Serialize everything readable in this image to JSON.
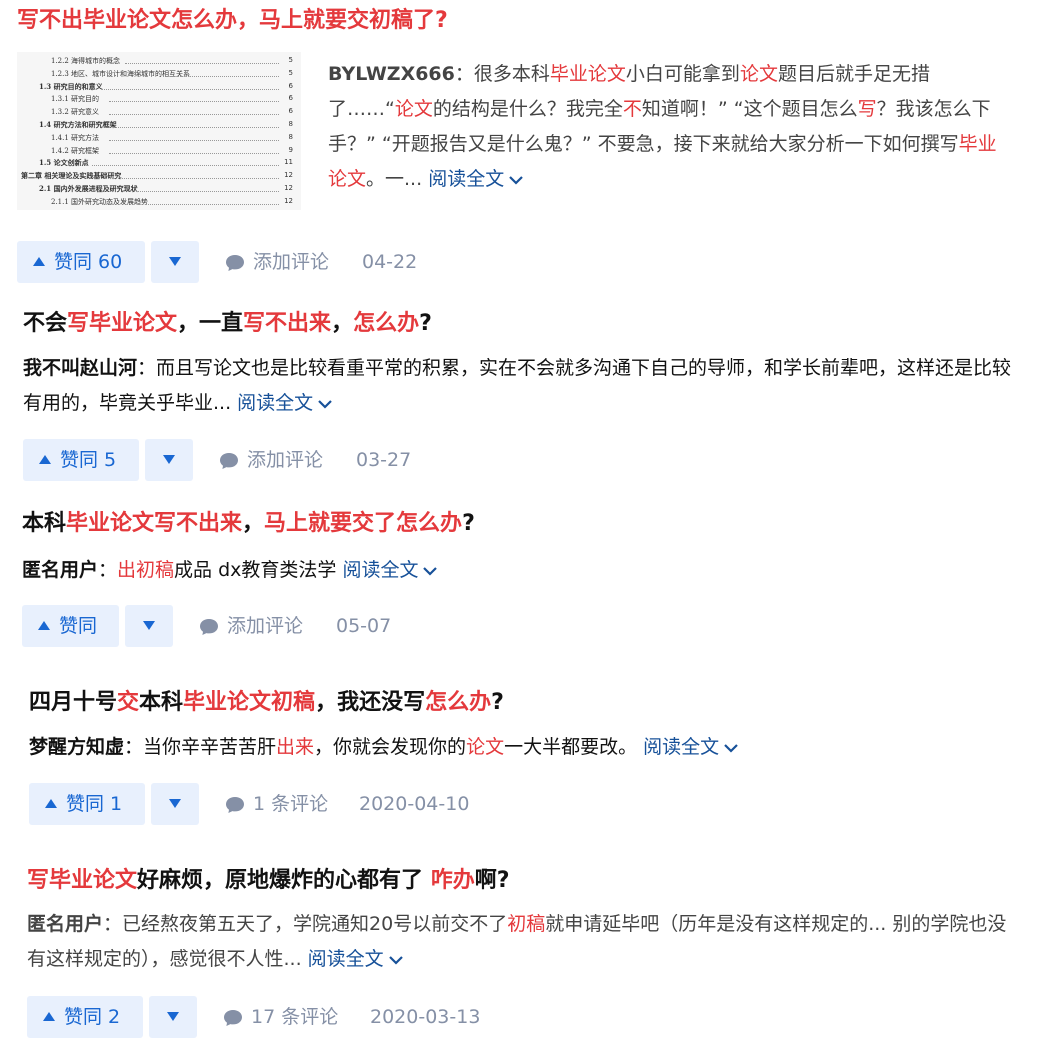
{
  "colors": {
    "highlight": "#e4393c",
    "link": "#175199",
    "vote_bg": "#e8f0fd",
    "vote_text": "#1967d2",
    "meta": "#8590a6"
  },
  "icons": {
    "comment": "speech-bubble-icon",
    "read_more": "chevron-down-icon",
    "upvote": "triangle-up-icon",
    "downvote": "triangle-down-icon"
  },
  "read_more_label": "阅读全文",
  "items": [
    {
      "title": [
        {
          "t": "写不出毕业论文怎么办，马上就要交初稿了?",
          "hl": true
        }
      ],
      "thumbnail": {
        "lines": [
          {
            "text": "1.2.2 海得城市的概念",
            "page": "5"
          },
          {
            "text": "1.2.3 地区、城市设计和海绵城市的相互关系",
            "page": "5"
          },
          {
            "text": "1.3 研究目的和意义",
            "page": "6"
          },
          {
            "text": "1.3.1 研究目的",
            "page": "6"
          },
          {
            "text": "1.3.2 研究意义",
            "page": "6"
          },
          {
            "text": "1.4 研究方法和研究框架",
            "page": "8"
          },
          {
            "text": "1.4.1 研究方法",
            "page": "8"
          },
          {
            "text": "1.4.2 研究框架",
            "page": "9"
          },
          {
            "text": "1.5 论文创新点",
            "page": "11"
          },
          {
            "text": "第二章 相关理论及实践基础研究",
            "page": "12"
          },
          {
            "text": "2.1 国内外发展进程及研究现状",
            "page": "12"
          },
          {
            "text": "2.1.1 国外研究动态及发展趋势",
            "page": "12"
          }
        ]
      },
      "author": "BYLWZX666",
      "excerpt": [
        {
          "t": "：很多本科"
        },
        {
          "t": "毕业论文",
          "hl": true
        },
        {
          "t": "小白可能拿到"
        },
        {
          "t": "论文",
          "hl": true
        },
        {
          "t": "题目后就手足无措了……“"
        },
        {
          "t": "论文",
          "hl": true
        },
        {
          "t": "的结构是什么？我完全"
        },
        {
          "t": "不",
          "hl": true
        },
        {
          "t": "知道啊！” “这个题目怎么"
        },
        {
          "t": "写",
          "hl": true
        },
        {
          "t": "？我该怎么下手？” “开题报告又是什么鬼？” 不要急，接下来就给大家分析一下如何撰写"
        },
        {
          "t": "毕业论文",
          "hl": true
        },
        {
          "t": "。一... "
        }
      ],
      "vote_label": "赞同 60",
      "comment_label": "添加评论",
      "date": "04-22"
    },
    {
      "title": [
        {
          "t": "不会"
        },
        {
          "t": "写毕业论文",
          "hl": true
        },
        {
          "t": "，一直"
        },
        {
          "t": "写不出来",
          "hl": true
        },
        {
          "t": "，"
        },
        {
          "t": "怎么办",
          "hl": true
        },
        {
          "t": "?"
        }
      ],
      "author": "我不叫赵山河",
      "excerpt": [
        {
          "t": "：而且写论文也是比较看重平常的积累，实在不会就多沟通下自己的导师，和学长前辈吧，这样还是比较有用的，毕竟关乎毕业... "
        }
      ],
      "vote_label": "赞同 5",
      "comment_label": "添加评论",
      "date": "03-27"
    },
    {
      "title": [
        {
          "t": "本科"
        },
        {
          "t": "毕业论文写不出来",
          "hl": true
        },
        {
          "t": "，"
        },
        {
          "t": "马上就要交了怎么办",
          "hl": true
        },
        {
          "t": "?"
        }
      ],
      "author": "匿名用户",
      "excerpt": [
        {
          "t": "："
        },
        {
          "t": "出初稿",
          "hl": true
        },
        {
          "t": "成品 dx教育类法学 "
        }
      ],
      "vote_label": "赞同",
      "comment_label": "添加评论",
      "date": "05-07"
    },
    {
      "title": [
        {
          "t": "四月十号"
        },
        {
          "t": "交",
          "hl": true
        },
        {
          "t": "本科"
        },
        {
          "t": "毕业论文初稿",
          "hl": true
        },
        {
          "t": "，我还没写"
        },
        {
          "t": "怎么办",
          "hl": true
        },
        {
          "t": "?"
        }
      ],
      "author": "梦醒方知虚",
      "excerpt": [
        {
          "t": "：当你辛辛苦苦肝"
        },
        {
          "t": "出来",
          "hl": true
        },
        {
          "t": "，你就会发现你的"
        },
        {
          "t": "论文",
          "hl": true
        },
        {
          "t": "一大半都要改。 "
        }
      ],
      "vote_label": "赞同 1",
      "comment_label": "1 条评论",
      "date": "2020-04-10"
    },
    {
      "title": [
        {
          "t": "写毕业论文",
          "hl": true
        },
        {
          "t": "好麻烦，原地爆炸的心都有了 "
        },
        {
          "t": "咋办",
          "hl": true
        },
        {
          "t": "啊?"
        }
      ],
      "author": "匿名用户",
      "excerpt": [
        {
          "t": "：已经熬夜第五天了，学院通知20号以前交不了"
        },
        {
          "t": "初稿",
          "hl": true
        },
        {
          "t": "就申请延毕吧（历年是没有这样规定的... 别的学院也没有这样规定的），感觉很不人性... "
        }
      ],
      "vote_label": "赞同 2",
      "comment_label": "17 条评论",
      "date": "2020-03-13"
    }
  ]
}
